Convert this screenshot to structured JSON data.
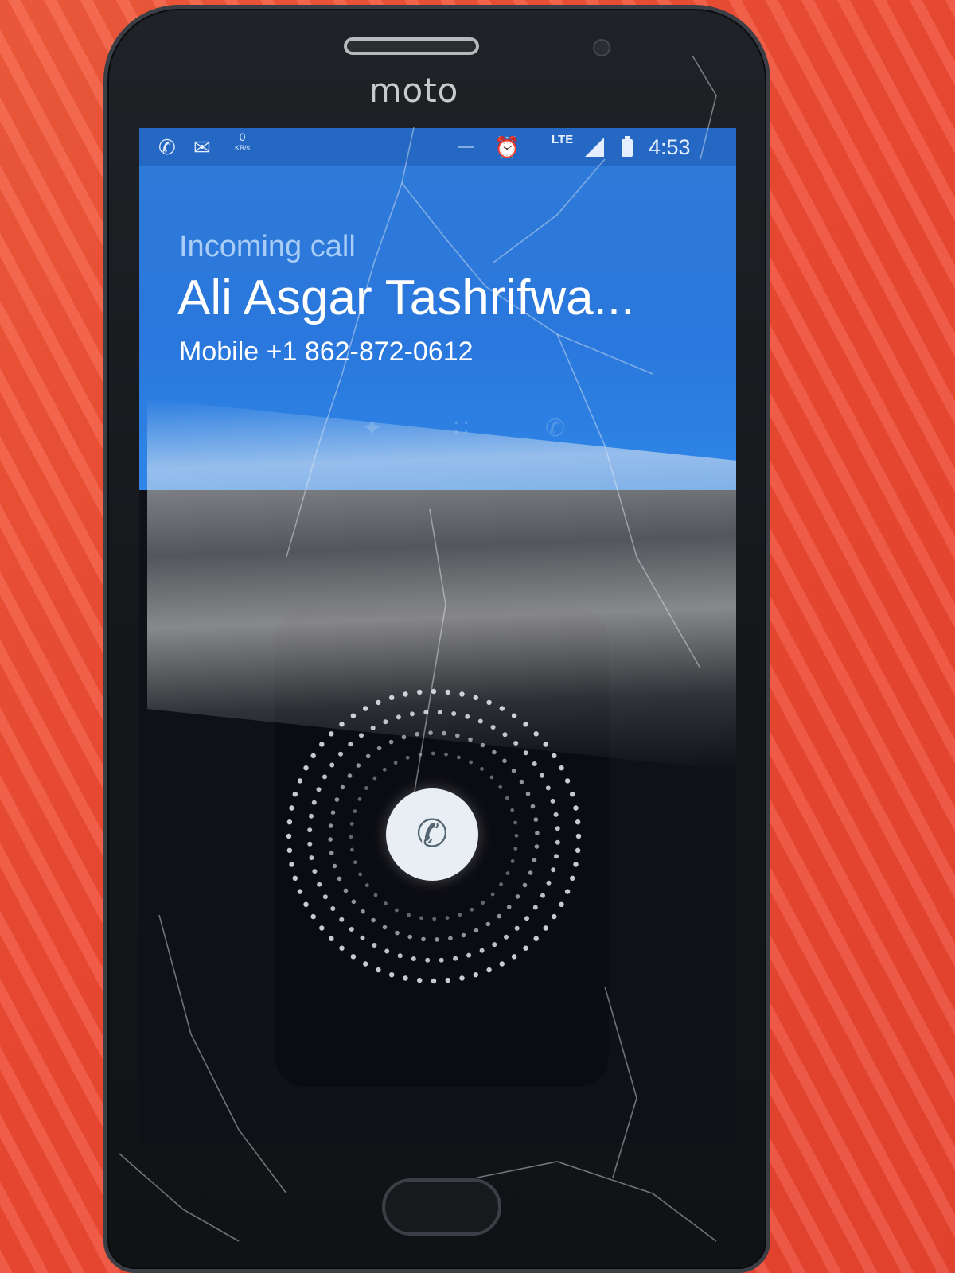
{
  "device": {
    "brand": "moto"
  },
  "status_bar": {
    "left_icons": [
      "phone-call-icon",
      "email-icon"
    ],
    "data_rate": "0",
    "data_rate_unit": "KB/s",
    "vibrate_icon": "vibrate-icon",
    "alarm_icon": "alarm-icon",
    "network": "LTE",
    "time": "4:53"
  },
  "call": {
    "label": "Incoming call",
    "caller_name": "Ali Asgar Tashrifwa...",
    "caller_number": "Mobile +1 862-872-0612"
  },
  "answer": {
    "icon": "phone-icon"
  },
  "colors": {
    "call_panel": "#2a78dd",
    "status_bar": "#2468c4",
    "background": "#ee4a32"
  }
}
